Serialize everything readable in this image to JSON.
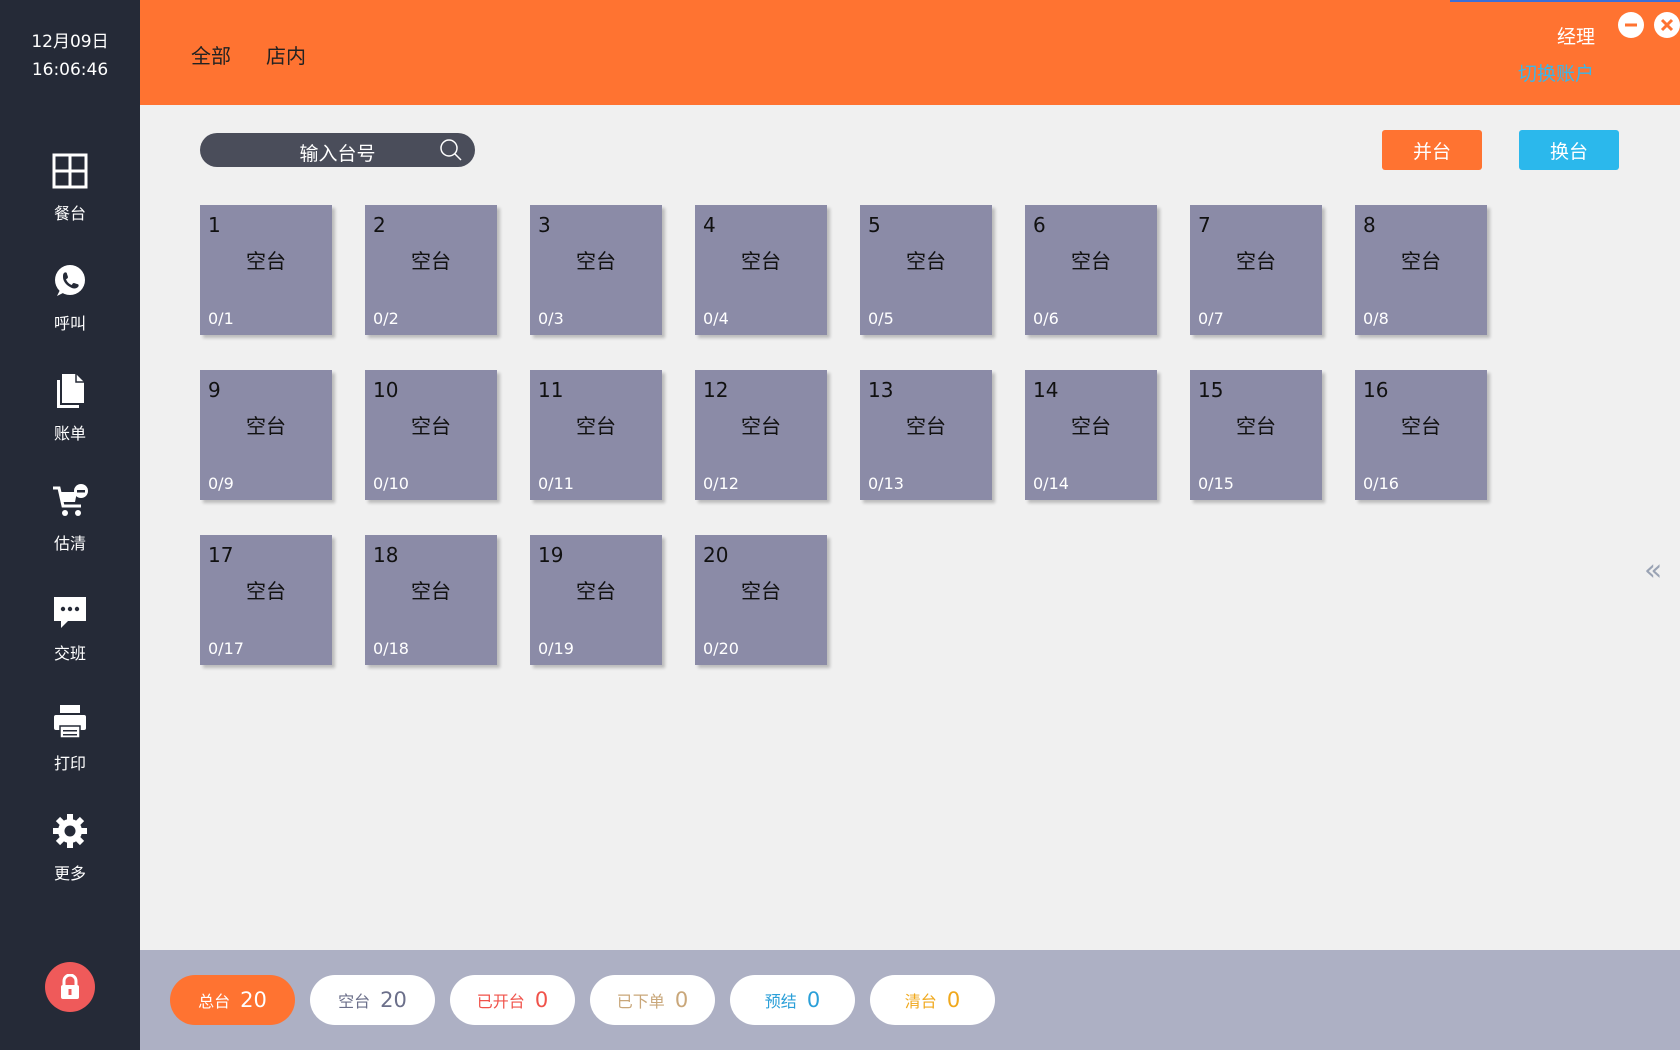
{
  "clock": {
    "date": "12月09日",
    "time": "16:06:46"
  },
  "sidebar": {
    "items": [
      {
        "label": "餐台",
        "icon": "plus-icon"
      },
      {
        "label": "呼叫",
        "icon": "phone-chat-icon"
      },
      {
        "label": "账单",
        "icon": "document-icon"
      },
      {
        "label": "估清",
        "icon": "cart-icon"
      },
      {
        "label": "交班",
        "icon": "message-icon"
      },
      {
        "label": "打印",
        "icon": "printer-icon"
      },
      {
        "label": "更多",
        "icon": "gear-icon"
      }
    ],
    "lock_icon": "lock-icon"
  },
  "header": {
    "tabs": [
      {
        "label": "全部"
      },
      {
        "label": "店内"
      }
    ],
    "user": "经理",
    "switch_account": "切换账户"
  },
  "search": {
    "placeholder": "输入台号"
  },
  "actions": {
    "merge": "并台",
    "swap": "换台"
  },
  "tables": [
    {
      "number": "1",
      "status": "空台",
      "seats": "0/1"
    },
    {
      "number": "2",
      "status": "空台",
      "seats": "0/2"
    },
    {
      "number": "3",
      "status": "空台",
      "seats": "0/3"
    },
    {
      "number": "4",
      "status": "空台",
      "seats": "0/4"
    },
    {
      "number": "5",
      "status": "空台",
      "seats": "0/5"
    },
    {
      "number": "6",
      "status": "空台",
      "seats": "0/6"
    },
    {
      "number": "7",
      "status": "空台",
      "seats": "0/7"
    },
    {
      "number": "8",
      "status": "空台",
      "seats": "0/8"
    },
    {
      "number": "9",
      "status": "空台",
      "seats": "0/9"
    },
    {
      "number": "10",
      "status": "空台",
      "seats": "0/10"
    },
    {
      "number": "11",
      "status": "空台",
      "seats": "0/11"
    },
    {
      "number": "12",
      "status": "空台",
      "seats": "0/12"
    },
    {
      "number": "13",
      "status": "空台",
      "seats": "0/13"
    },
    {
      "number": "14",
      "status": "空台",
      "seats": "0/14"
    },
    {
      "number": "15",
      "status": "空台",
      "seats": "0/15"
    },
    {
      "number": "16",
      "status": "空台",
      "seats": "0/16"
    },
    {
      "number": "17",
      "status": "空台",
      "seats": "0/17"
    },
    {
      "number": "18",
      "status": "空台",
      "seats": "0/18"
    },
    {
      "number": "19",
      "status": "空台",
      "seats": "0/19"
    },
    {
      "number": "20",
      "status": "空台",
      "seats": "0/20"
    }
  ],
  "stats": [
    {
      "label": "总台",
      "value": "20",
      "color": "#ffffff",
      "bg": "#ff7331"
    },
    {
      "label": "空台",
      "value": "20",
      "color": "#6b6f8a",
      "bg": "#ffffff"
    },
    {
      "label": "已开台",
      "value": "0",
      "color": "#f0524a",
      "bg": "#ffffff"
    },
    {
      "label": "已下单",
      "value": "0",
      "color": "#c9a77a",
      "bg": "#ffffff"
    },
    {
      "label": "预结",
      "value": "0",
      "color": "#2a9fd8",
      "bg": "#ffffff"
    },
    {
      "label": "清台",
      "value": "0",
      "color": "#f0a81c",
      "bg": "#ffffff"
    }
  ],
  "colors": {
    "sidebar": "#252a37",
    "header": "#ff7331",
    "table_card": "#8b8ba7",
    "status_bar": "#adb0c4",
    "swap_button": "#2bb8ec"
  }
}
